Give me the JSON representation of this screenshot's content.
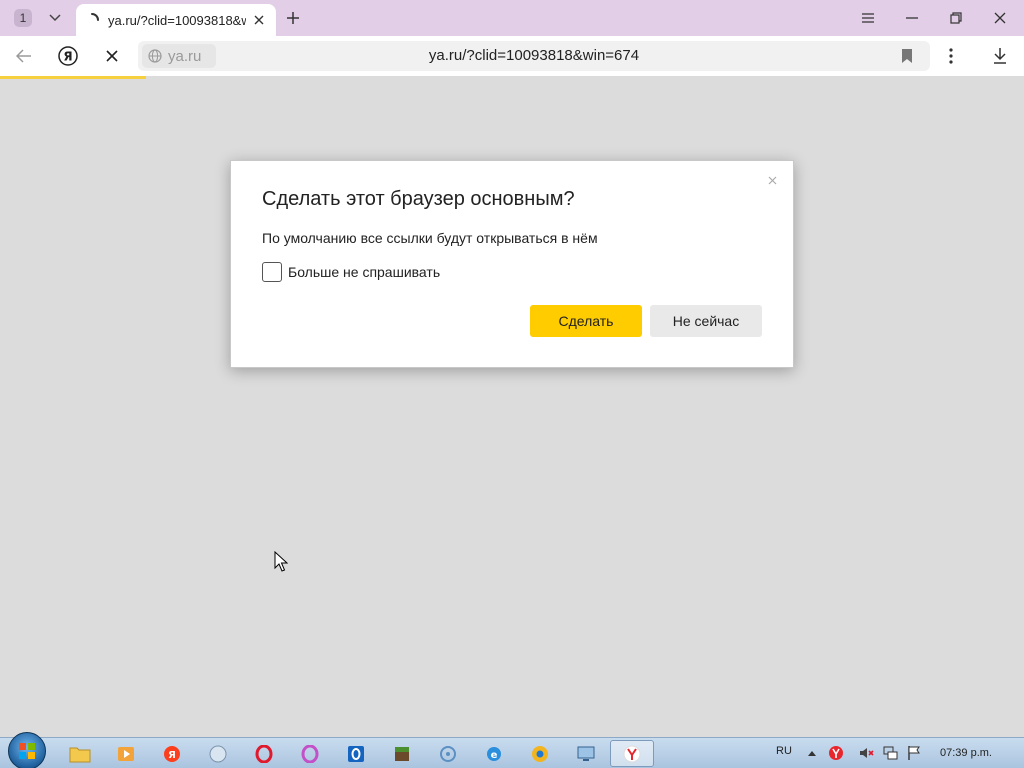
{
  "tabs": {
    "count": "1",
    "active": {
      "title": "ya.ru/?clid=10093818&win=674"
    }
  },
  "toolbar": {
    "site_domain": "ya.ru",
    "url": "ya.ru/?clid=10093818&win=674"
  },
  "dialog": {
    "title": "Сделать этот браузер основным?",
    "text": "По умолчанию все ссылки будут открываться в нём",
    "checkbox_label": "Больше не спрашивать",
    "checkbox_checked": false,
    "primary_button": "Сделать",
    "secondary_button": "Не сейчас"
  },
  "taskbar": {
    "language": "RU",
    "clock": "07:39 p.m."
  },
  "colors": {
    "accent": "#ffcc00",
    "titlebar": "#e2cfe7",
    "page_background": "#dcdcdc"
  }
}
